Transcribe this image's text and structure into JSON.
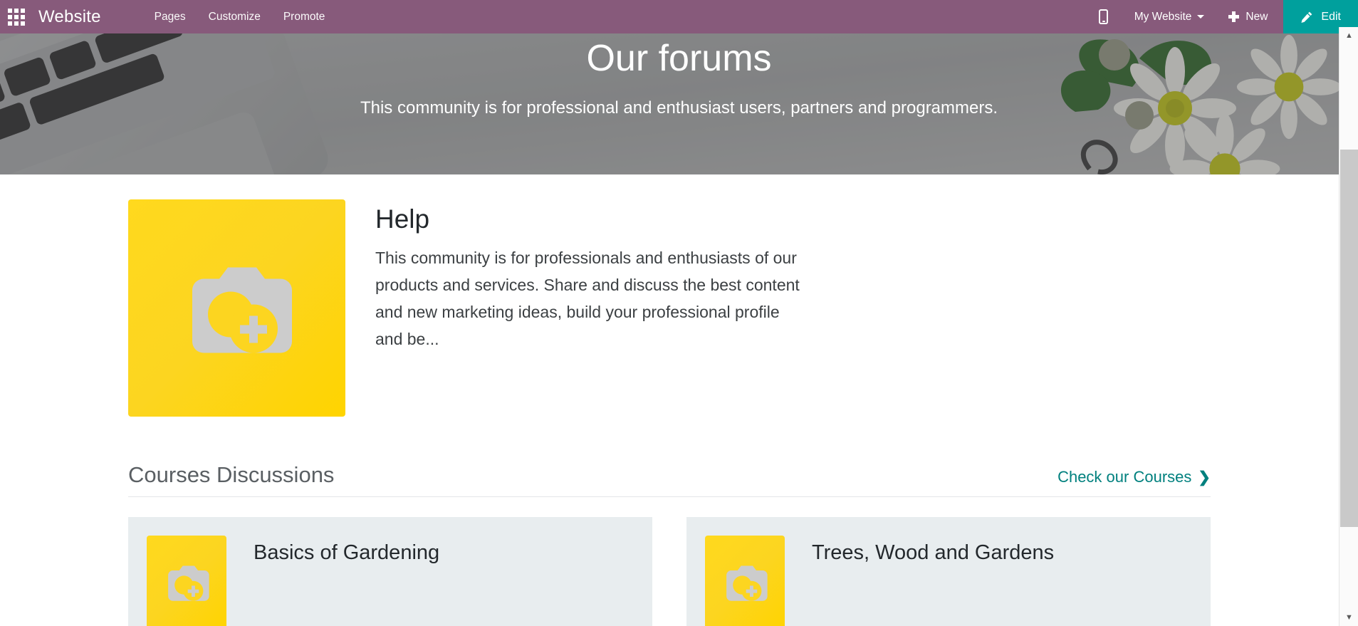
{
  "navbar": {
    "apps_icon": "apps-grid-icon",
    "brand": "Website",
    "menu": [
      {
        "label": "Pages"
      },
      {
        "label": "Customize"
      },
      {
        "label": "Promote"
      }
    ],
    "mobile_preview_icon": "mobile-phone-icon",
    "site_selector": "My Website",
    "new_label": "New",
    "new_icon": "plus-icon",
    "edit_label": "Edit",
    "edit_icon": "pencil-icon",
    "colors": {
      "navbar_bg": "#875a7b",
      "edit_bg": "#00a09d"
    }
  },
  "hero": {
    "title": "Our forums",
    "subtitle": "This community is for professional and enthusiast users, partners and programmers."
  },
  "intro": {
    "image_alt": "add-photo-placeholder",
    "title": "Help",
    "body": "This community is for professionals and enthusiasts of our products and services. Share and discuss the best content and new marketing ideas, build your professional profile and be..."
  },
  "section": {
    "title": "Courses Discussions",
    "link_label": "Check our Courses",
    "link_icon": "chevron-right-icon",
    "link_color": "#00807e"
  },
  "cards": [
    {
      "title": "Basics of Gardening",
      "image_alt": "add-photo-placeholder"
    },
    {
      "title": "Trees, Wood and Gardens",
      "image_alt": "add-photo-placeholder"
    }
  ],
  "scrollbar": {
    "up_arrow": "chevron-up-icon",
    "down_arrow": "chevron-down-icon"
  }
}
